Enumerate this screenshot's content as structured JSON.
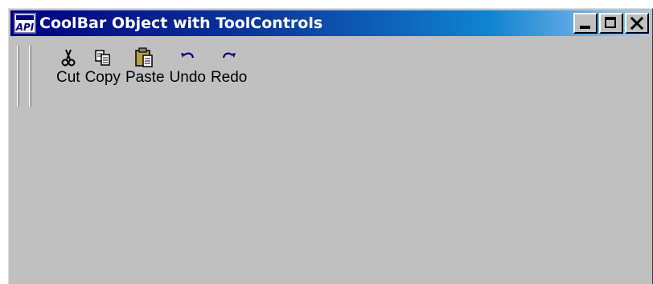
{
  "window": {
    "title": "CoolBar Object with ToolControls",
    "app_icon": "api-app-icon",
    "caption_buttons": [
      {
        "name": "minimize",
        "icon": "minimize-icon"
      },
      {
        "name": "maximize",
        "icon": "maximize-icon"
      },
      {
        "name": "close",
        "icon": "close-icon"
      }
    ]
  },
  "toolbar": {
    "buttons": [
      {
        "label": "Cut",
        "icon": "scissors-icon"
      },
      {
        "label": "Copy",
        "icon": "copy-icon"
      },
      {
        "label": "Paste",
        "icon": "paste-icon"
      },
      {
        "label": "Undo",
        "icon": "undo-icon"
      },
      {
        "label": "Redo",
        "icon": "redo-icon"
      }
    ]
  },
  "colors": {
    "titlebar_start": "#000080",
    "titlebar_end": "#a6caf0",
    "face": "#c0c0c0"
  }
}
